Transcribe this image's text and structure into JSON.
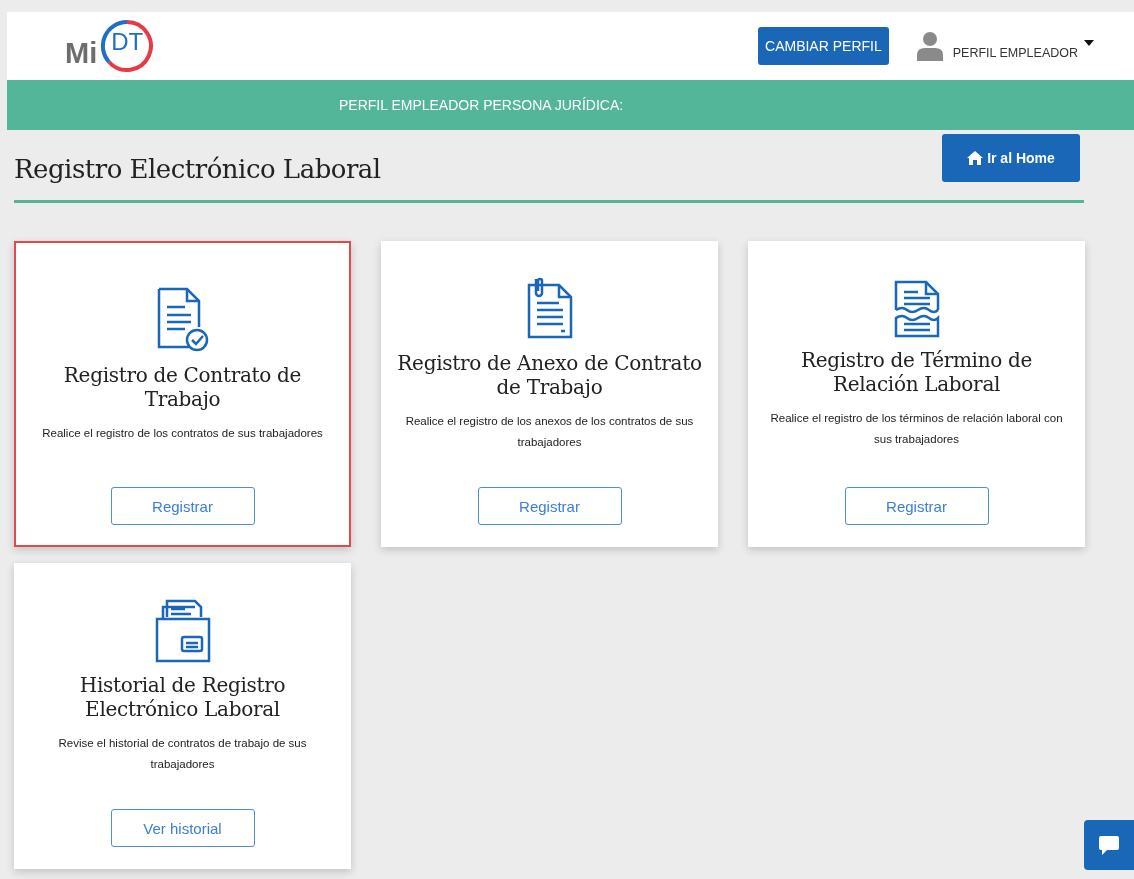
{
  "header": {
    "logo": {
      "prefix": "Mi",
      "badge": "DT"
    },
    "switch_button": "CAMBIAR PERFIL",
    "profile": "PERFIL EMPLEADOR"
  },
  "banner": "PERFIL EMPLEADOR PERSONA JURÍDICA:",
  "page": {
    "title": "Registro Electrónico Laboral",
    "home_button": "Ir al Home"
  },
  "cards": [
    {
      "kind": "contract",
      "title": "Registro de Contrato de Trabajo",
      "description": "Realice el registro de los contratos de sus trabajadores",
      "button": "Registrar",
      "highlighted": true
    },
    {
      "kind": "annex",
      "title": "Registro de Anexo de Contrato de Trabajo",
      "description": "Realice el registro de los anexos de los contratos de sus trabajadores",
      "button": "Registrar",
      "highlighted": false
    },
    {
      "kind": "termination",
      "title": "Registro de Término de Relación Laboral",
      "description": "Realice el registro de los términos de relación laboral con sus trabajadores",
      "button": "Registrar",
      "highlighted": false
    },
    {
      "kind": "history",
      "title": "Historial de Registro Electrónico Laboral",
      "description": "Revise el historial de contratos de trabajo de sus trabajadores",
      "button": "Ver historial",
      "highlighted": false
    }
  ]
}
